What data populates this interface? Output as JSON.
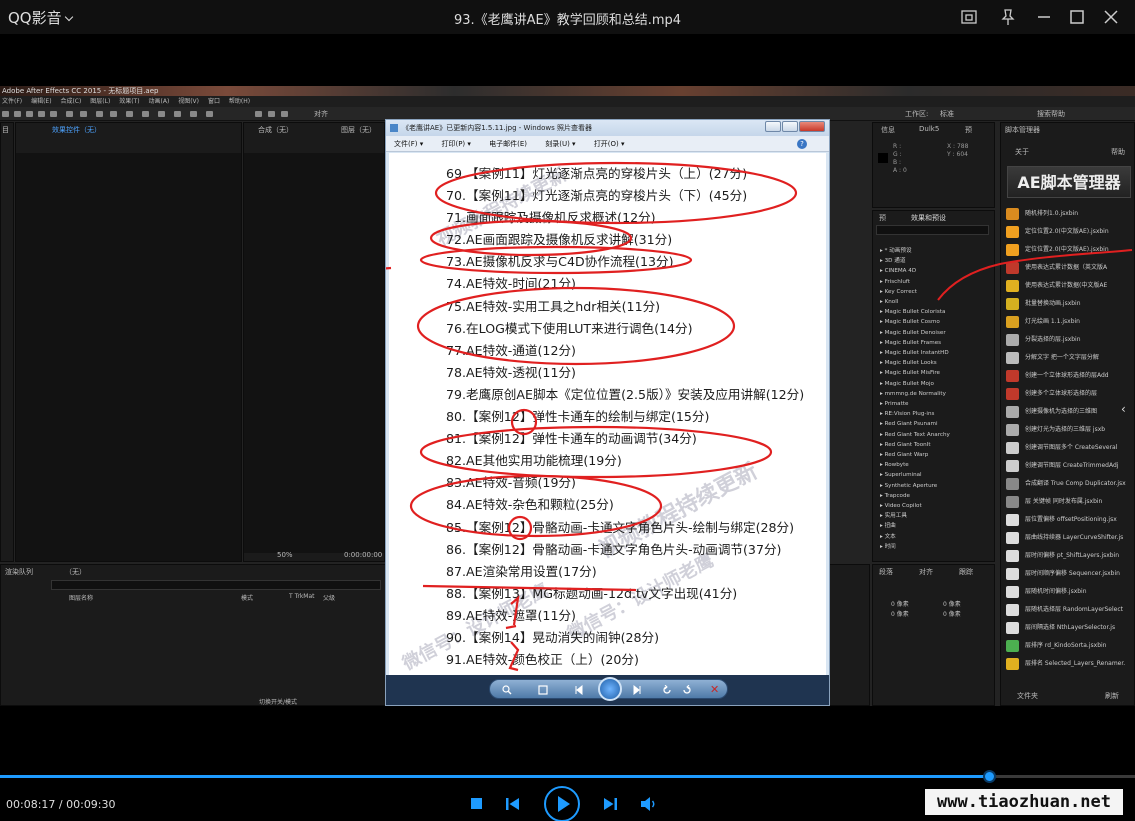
{
  "player": {
    "app_name": "QQ影音",
    "file_title": "93.《老鹰讲AE》教学回顾和总结.mp4",
    "time_current": "00:08:17",
    "time_total": "00:09:30",
    "time_separator": " / ",
    "progress": 0.871,
    "accent_color": "#1e9bff",
    "buttons": [
      "stop-icon",
      "previous-icon",
      "play-icon",
      "next-icon",
      "volume-icon"
    ],
    "title_icons": [
      "screenshot-icon",
      "pin-icon",
      "minimize-icon",
      "maximize-icon",
      "close-icon"
    ],
    "site_watermark": "www.tiaozhuan.net"
  },
  "ae": {
    "title": "Adobe After Effects CC 2015 - 无标题项目.aep",
    "menu": [
      "文件(F)",
      "编辑(E)",
      "合成(C)",
      "图层(L)",
      "效果(T)",
      "动画(A)",
      "视图(V)",
      "窗口",
      "帮助(H)"
    ],
    "snap": "对齐",
    "workspace_label": "工作区:",
    "workspace_value": "标准",
    "search_help": "搜索帮助",
    "panels": {
      "project_tab": "目",
      "effect_controls": "效果控件（无）",
      "comp_tab": "合成（无）",
      "layer_tab": "图层（无）",
      "info": "信息",
      "audio": "Dulk5",
      "preview": "预",
      "effects_presets": "效果和预设",
      "script_manager": "脚本管理器",
      "sm_tab1": "关于",
      "sm_tab2": "帮助",
      "render_queue": "渲染队列",
      "timeline_tab": "（无）",
      "align": "对齐",
      "paragraph": "段落",
      "tracker": "跟踪",
      "layer_name_col": "图层名称",
      "mode_col": "模式",
      "trkmat_col": "T TrkMat",
      "parent_col": "父级",
      "toggle_modes": "切换开关/模式",
      "zoom": "50%",
      "timecode": "0:00:00:00"
    },
    "info": {
      "r": "R :",
      "g": "G :",
      "b": "B :",
      "a": "A : 0",
      "x": "X : 788",
      "y": "Y : 604"
    },
    "effects_list": [
      "▸ * 动画预设",
      "▸ 3D 通道",
      "▸ CINEMA 4D",
      "▸ Frischluft",
      "▸ Key Correct",
      "▸ Knoll",
      "▸ Magic Bullet Colorista",
      "▸ Magic Bullet Cosmo",
      "▸ Magic Bullet Denoiser",
      "▸ Magic Bullet Frames",
      "▸ Magic Bullet InstantHD",
      "▸ Magic Bullet Looks",
      "▸ Magic Bullet MisFire",
      "▸ Magic Bullet Mojo",
      "▸ mmmng.de Normality",
      "▸ Primatte",
      "▸ RE:Vision Plug-ins",
      "▸ Red Giant Psunami",
      "▸ Red Giant Text Anarchy",
      "▸ Red Giant ToonIt",
      "▸ Red Giant Warp",
      "▸ Rowbyte",
      "▸ Superluminal",
      "▸ Synthetic Aperture",
      "▸ Trapcode",
      "▸ Video Copilot",
      "▸ 实用工具",
      "▸ 扭曲",
      "▸ 文本",
      "▸ 时间"
    ],
    "script_manager_logo": "AE脚本管理器",
    "scripts": [
      {
        "name": "随机排列1.0.jsxbin",
        "color": "#d98b1f"
      },
      {
        "name": "定位位置2.0(中文版AE).jsxbin",
        "color": "#f0a020"
      },
      {
        "name": "定位位置2.0(中文版AE).jsxbin",
        "color": "#f0a020"
      },
      {
        "name": "使用表达式累计数据（英文版A",
        "color": "#c0392b"
      },
      {
        "name": "使用表达式累计数据(中文版AE",
        "color": "#e0b020"
      },
      {
        "name": "批量替换动画.jsxbin",
        "color": "#d4b020"
      },
      {
        "name": "灯光绘画 1.1.jsxbin",
        "color": "#d9a020"
      },
      {
        "name": "分裂选择的层.jsxbin",
        "color": "#aaaaaa"
      },
      {
        "name": "分解文字 把一个文字层分解",
        "color": "#bbbbbb"
      },
      {
        "name": "创建一个立体球形选择的层Add",
        "color": "#c0392b"
      },
      {
        "name": "创建多个立体球形选择的层",
        "color": "#c0392b"
      },
      {
        "name": "创建摄像机为选择的三维图",
        "color": "#aaaaaa"
      },
      {
        "name": "创建灯光为选择的三维层 jsxb",
        "color": "#aaaaaa"
      },
      {
        "name": "创建调节图层多个 CreateSeveral",
        "color": "#cccccc"
      },
      {
        "name": "创建调节图层 CreateTrimmedAdj",
        "color": "#cccccc"
      },
      {
        "name": "合成翻译 True Comp Duplicator.jsx",
        "color": "#888888"
      },
      {
        "name": "层 关键帧 同时发布属.jsxbin",
        "color": "#888888"
      },
      {
        "name": "层位置偏移 offsetPositioning.jsx",
        "color": "#dddddd"
      },
      {
        "name": "层曲线持续器 LayerCurveShifter.js",
        "color": "#dddddd"
      },
      {
        "name": "层时间偏移 pt_ShiftLayers.jsxbin",
        "color": "#dddddd"
      },
      {
        "name": "层时间顺序偏移 Sequencer.jsxbin",
        "color": "#dddddd"
      },
      {
        "name": "层随机时间偏移.jsxbin",
        "color": "#dddddd"
      },
      {
        "name": "层随机选择层 RandomLayerSelect",
        "color": "#dddddd"
      },
      {
        "name": "层间隔选择 NthLayerSelector.js",
        "color": "#dddddd"
      },
      {
        "name": "层排序 rd_KindoSorta.jsxbin",
        "color": "#4caf50"
      },
      {
        "name": "层排名 Selected_Layers_Renamer.",
        "color": "#e0b020"
      }
    ],
    "sm_bottom_left": "文件夹",
    "sm_bottom_right": "刷新",
    "align_labels": [
      "0 像素",
      "0 像素",
      "0 像素",
      "0 像素"
    ]
  },
  "viewer": {
    "title": "《老鹰讲AE》已更新内容1.5.11.jpg - Windows 照片查看器",
    "menu": [
      "文件(F) ▾",
      "打印(P) ▾",
      "电子邮件(E)",
      "刻录(U) ▾",
      "打开(O) ▾"
    ],
    "help": "?",
    "lines": [
      "69.【案例11】灯光逐渐点亮的穿梭片头（上）(27分)",
      "70.【案例11】灯光逐渐点亮的穿梭片头（下）(45分)",
      "71.画面跟踪及摄像机反求概述(12分)",
      "72.AE画面跟踪及摄像机反求讲解(31分)",
      "73.AE摄像机反求与C4D协作流程(13分)",
      "74.AE特效-时间(21分)",
      "75.AE特效-实用工具之hdr相关(11分)",
      "76.在LOG模式下使用LUT来进行调色(14分)",
      "77.AE特效-通道(12分)",
      "78.AE特效-透视(11分)",
      "79.老鹰原创AE脚本《定位位置(2.5版）》安装及应用讲解(12分)",
      "80.【案例12】弹性卡通车的绘制与绑定(15分)",
      "81.【案例12】弹性卡通车的动画调节(34分)",
      "82.AE其他实用功能梳理(19分)",
      "83.AE特效-音频(19分)",
      "84.AE特效-杂色和颗粒(25分)",
      "85.【案例12】骨骼动画-卡通文字角色片头-绘制与绑定(28分)",
      "86.【案例12】骨骼动画-卡通文字角色片头-动画调节(37分)",
      "87.AE渲染常用设置(17分)",
      "88.【案例13】MG标题动画-12d.tv文字出现(41分)",
      "89.AE特效-遮罩(11分)",
      "90.【案例14】晃动消失的闹钟(28分)",
      "91.AE特效-颜色校正（上）(20分)"
    ],
    "watermark_1": "视频教程持续更新",
    "watermark_2": "微信号：设计师老鹰",
    "watermark_3": "计师老鹰",
    "annotation_color": "#e02020"
  }
}
